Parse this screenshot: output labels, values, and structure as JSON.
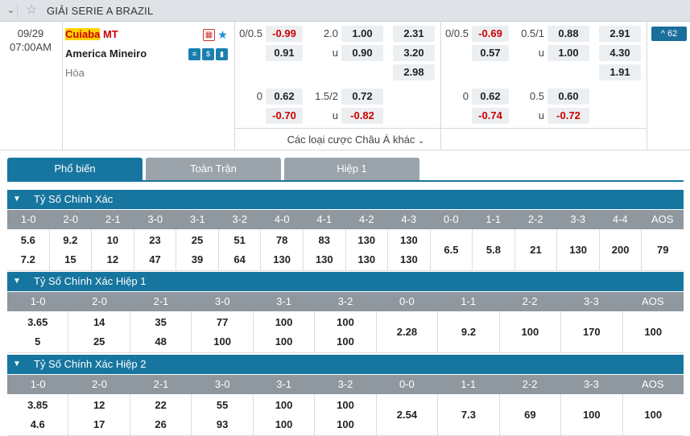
{
  "league": {
    "name": "GIẢI SERIE A BRAZIL"
  },
  "match": {
    "date": "09/29",
    "time": "07:00AM",
    "home_prefix": "Cuiaba",
    "home_suffix": " MT",
    "away": "America Mineiro",
    "draw": "Hòa",
    "more_count": "62",
    "more_label": "^ 62"
  },
  "odds": {
    "ft_hdp_line": "0/0.5",
    "ft_hdp_home": "-0.99",
    "ft_hdp_away": "0.91",
    "ft_ou_line": "2.0",
    "ft_ou_u": "u",
    "ft_ou_over": "1.00",
    "ft_ou_under": "0.90",
    "ft_1x2_home": "2.31",
    "ft_1x2_away": "3.20",
    "ft_1x2_draw": "2.98",
    "h1_hdp_line": "0/0.5",
    "h1_hdp_home": "-0.69",
    "h1_hdp_away": "0.57",
    "h1_ou_line": "0.5/1",
    "h1_ou_u": "u",
    "h1_ou_over": "0.88",
    "h1_ou_under": "1.00",
    "h1_1x2_home": "2.91",
    "h1_1x2_away": "4.30",
    "h1_1x2_draw": "1.91",
    "ft2_hdp_line": "0",
    "ft2_hdp_home": "0.62",
    "ft2_hdp_away": "-0.70",
    "ft2_ou_line": "1.5/2",
    "ft2_ou_u": "u",
    "ft2_ou_over": "0.72",
    "ft2_ou_under": "-0.82",
    "h12_hdp_line": "0",
    "h12_hdp_home": "0.62",
    "h12_hdp_away": "-0.74",
    "h12_ou_line": "0.5",
    "h12_ou_u": "u",
    "h12_ou_over": "0.60",
    "h12_ou_under": "-0.72",
    "other_asian": "Các loại cược Châu Á khác"
  },
  "tabs": [
    {
      "label": "Phổ biến"
    },
    {
      "label": "Toàn Trận"
    },
    {
      "label": "Hiệp 1"
    }
  ],
  "sections": [
    {
      "title": "Tỷ Số Chính Xác",
      "headers": [
        "1-0",
        "2-0",
        "2-1",
        "3-0",
        "3-1",
        "3-2",
        "4-0",
        "4-1",
        "4-2",
        "4-3",
        "0-0",
        "1-1",
        "2-2",
        "3-3",
        "4-4",
        "AOS"
      ],
      "cells": [
        [
          "5.6",
          "7.2"
        ],
        [
          "9.2",
          "15"
        ],
        [
          "10",
          "12"
        ],
        [
          "23",
          "47"
        ],
        [
          "25",
          "39"
        ],
        [
          "51",
          "64"
        ],
        [
          "78",
          "130"
        ],
        [
          "83",
          "130"
        ],
        [
          "130",
          "130"
        ],
        [
          "130",
          "130"
        ],
        [
          "6.5"
        ],
        [
          "5.8"
        ],
        [
          "21"
        ],
        [
          "130"
        ],
        [
          "200"
        ],
        [
          "79"
        ]
      ]
    },
    {
      "title": "Tỷ Số Chính Xác Hiệp 1",
      "headers": [
        "1-0",
        "2-0",
        "2-1",
        "3-0",
        "3-1",
        "3-2",
        "0-0",
        "1-1",
        "2-2",
        "3-3",
        "AOS"
      ],
      "cells": [
        [
          "3.65",
          "5"
        ],
        [
          "14",
          "25"
        ],
        [
          "35",
          "48"
        ],
        [
          "77",
          "100"
        ],
        [
          "100",
          "100"
        ],
        [
          "100",
          "100"
        ],
        [
          "2.28"
        ],
        [
          "9.2"
        ],
        [
          "100"
        ],
        [
          "170"
        ],
        [
          "100"
        ]
      ]
    },
    {
      "title": "Tỷ Số Chính Xác Hiệp 2",
      "headers": [
        "1-0",
        "2-0",
        "2-1",
        "3-0",
        "3-1",
        "3-2",
        "0-0",
        "1-1",
        "2-2",
        "3-3",
        "AOS"
      ],
      "cells": [
        [
          "3.85",
          "4.6"
        ],
        [
          "12",
          "17"
        ],
        [
          "22",
          "26"
        ],
        [
          "55",
          "93"
        ],
        [
          "100",
          "100"
        ],
        [
          "100",
          "100"
        ],
        [
          "2.54"
        ],
        [
          "7.3"
        ],
        [
          "69"
        ],
        [
          "100"
        ],
        [
          "100"
        ]
      ]
    }
  ],
  "colors": {
    "accent": "#17769f",
    "header_gray": "#8f979f",
    "negative": "#cc0000",
    "highlight": "#ffd200"
  }
}
